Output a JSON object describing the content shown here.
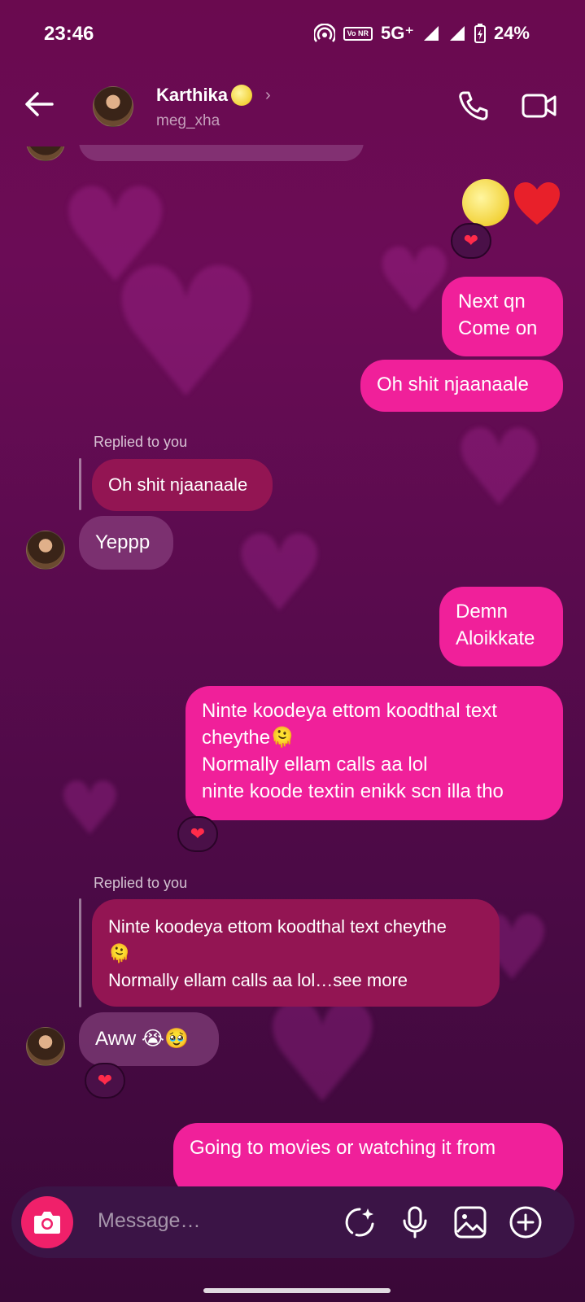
{
  "status_bar": {
    "time": "23:46",
    "network": "5G⁺",
    "volte": "Vo NR",
    "battery": "24%"
  },
  "header": {
    "name": "Karthika",
    "handle": "meg_xha"
  },
  "messages": {
    "emoji_reaction": "❤",
    "out_1_line1": "Next qn",
    "out_1_line2": "Come on",
    "out_2": "Oh shit njaanaale",
    "replied_label_1": "Replied to you",
    "quoted_1": "Oh shit njaanaale",
    "in_1": "Yeppp",
    "out_3_line1": "Demn",
    "out_3_line2": "Aloikkate",
    "out_4_line1": "Ninte koodeya ettom koodthal text",
    "out_4_line2": "cheythe🫠",
    "out_4_line3": "Normally ellam calls aa lol",
    "out_4_line4": "ninte koode textin enikk scn illa tho",
    "replied_label_2": "Replied to you",
    "quoted_2_line1": "Ninte koodeya ettom koodthal text cheythe",
    "quoted_2_line2": "🫠",
    "quoted_2_line3": "Normally ellam calls aa lol…see more",
    "in_2": "Aww 😭🥹",
    "out_5": "Going to movies or watching it from"
  },
  "reactions": {
    "heart": "❤"
  },
  "composer": {
    "placeholder": "Message…"
  },
  "colors": {
    "outgoing_bubble": "#f0209a",
    "camera_button": "#f0206a",
    "background": "#6a0a4f"
  },
  "icons": [
    "back-arrow-icon",
    "phone-icon",
    "video-camera-icon",
    "camera-icon",
    "sticker-icon",
    "microphone-icon",
    "gallery-icon",
    "plus-icon",
    "heart-icon"
  ]
}
